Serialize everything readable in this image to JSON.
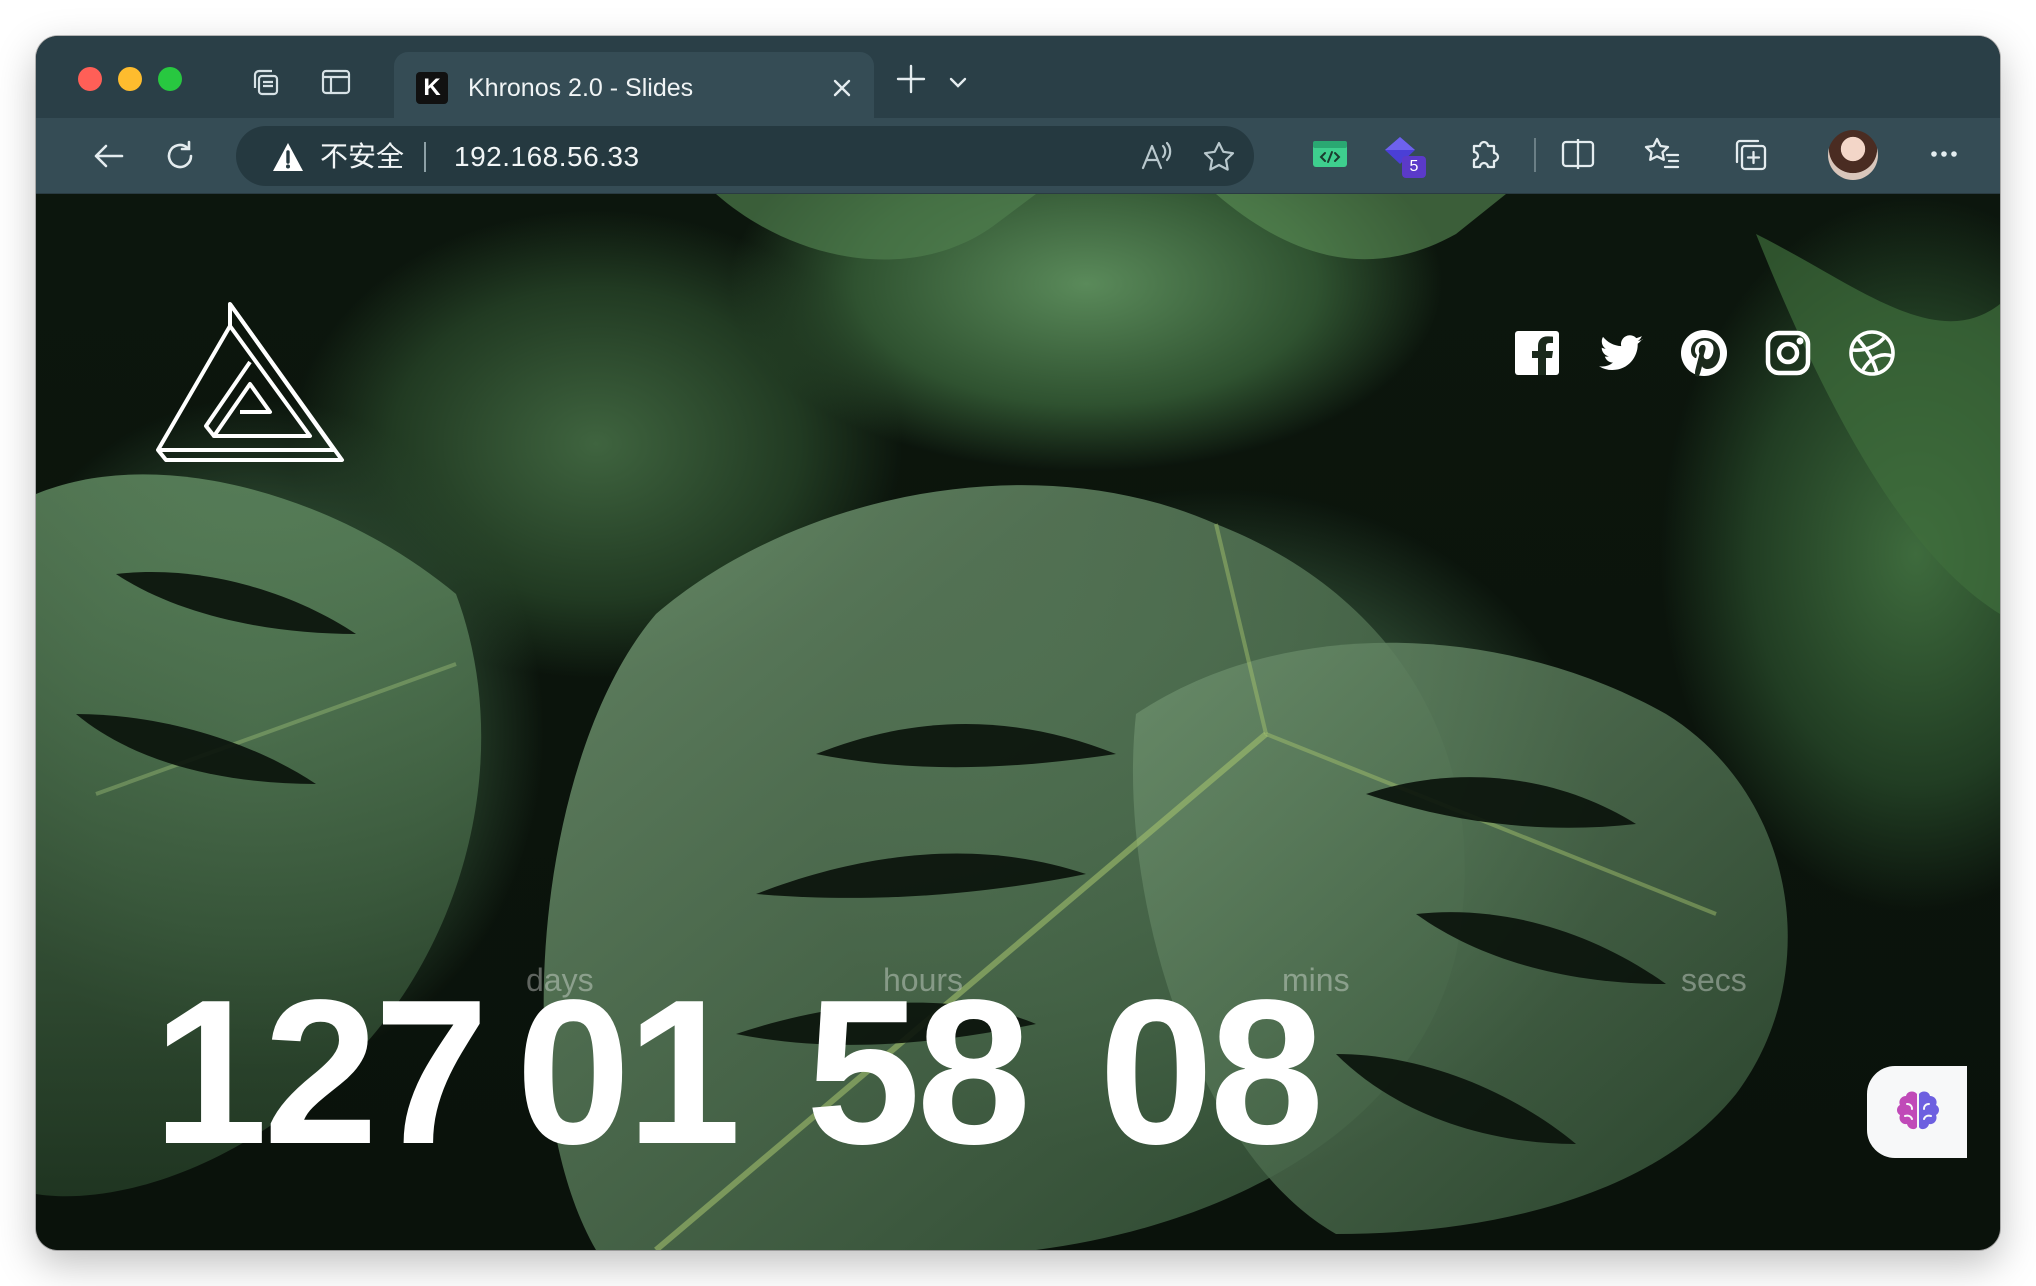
{
  "browser": {
    "tab": {
      "favicon": "K",
      "title": "Khronos 2.0 - Slides"
    },
    "address": {
      "security_label": "不安全",
      "url": "192.168.56.33"
    },
    "extension_badge": "5",
    "icons": [
      "workspaces-icon",
      "tab-actions-icon",
      "close-icon",
      "new-tab-icon",
      "tab-list-icon",
      "back-icon",
      "refresh-icon",
      "warning-icon",
      "read-aloud-icon",
      "favorite-star-icon",
      "dev-tools-extension-icon",
      "gem-extension-icon",
      "extensions-icon",
      "split-screen-icon",
      "favorites-icon",
      "collections-icon",
      "profile-avatar",
      "more-icon"
    ]
  },
  "page": {
    "social": [
      "facebook-icon",
      "twitter-icon",
      "pinterest-icon",
      "instagram-icon",
      "dribbble-icon"
    ],
    "countdown": {
      "days": {
        "value": "127",
        "label": "days"
      },
      "hours": {
        "value": "01",
        "label": "hours"
      },
      "mins": {
        "value": "58",
        "label": "mins"
      },
      "secs": {
        "value": "08",
        "label": "secs"
      }
    },
    "assistant_icon": "brain-icon",
    "colors": {
      "countdown": "#ffffff",
      "unit_label": "rgba(255,255,255,0.35)",
      "chrome": "#354c55"
    }
  }
}
